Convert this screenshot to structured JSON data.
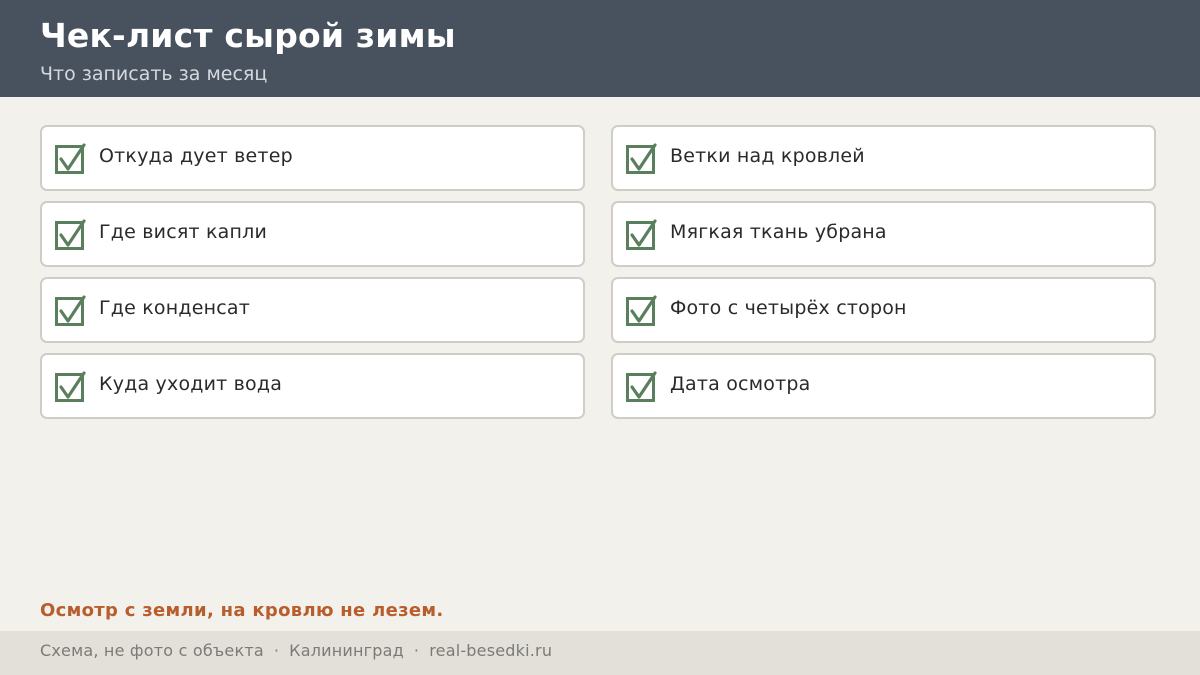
{
  "header": {
    "title": "Чек-лист сырой зимы",
    "subtitle": "Что записать за месяц"
  },
  "checklist": {
    "left": [
      {
        "label": "Откуда дует ветер",
        "checked": true
      },
      {
        "label": "Где висят капли",
        "checked": true
      },
      {
        "label": "Где конденсат",
        "checked": true
      },
      {
        "label": "Куда уходит вода",
        "checked": true
      }
    ],
    "right": [
      {
        "label": "Ветки над кровлей",
        "checked": true
      },
      {
        "label": "Мягкая ткань убрана",
        "checked": true
      },
      {
        "label": "Фото с четырёх сторон",
        "checked": true
      },
      {
        "label": "Дата осмотра",
        "checked": true
      }
    ]
  },
  "warning": "Осмотр с земли, на кровлю не лезем.",
  "footer": {
    "parts": [
      "Схема, не фото с объекта",
      "Калининград",
      "real-besedki.ru"
    ],
    "separator": "·"
  },
  "colors": {
    "header_bg": "#48515e",
    "check": "#5a7f5c",
    "warning": "#b85d2c",
    "page_bg": "#f3f1ec"
  },
  "icons": {
    "checkbox": "checked-checkbox-icon"
  }
}
